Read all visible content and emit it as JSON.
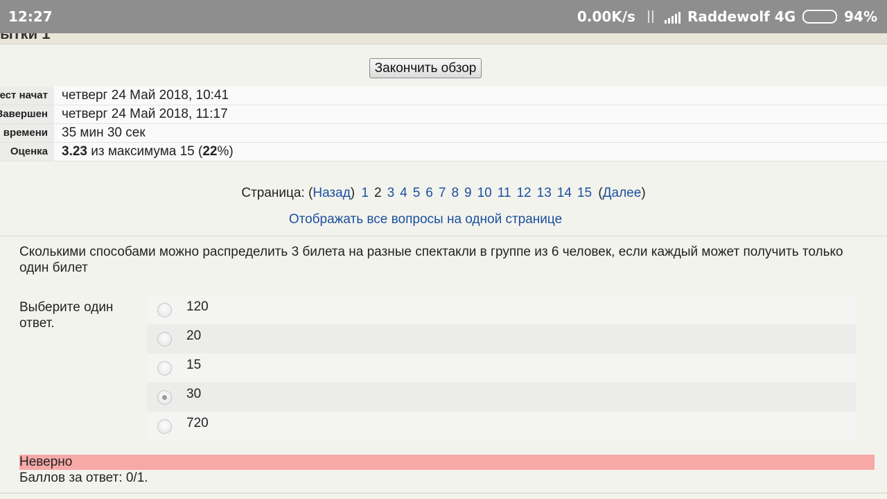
{
  "statusbar": {
    "time": "12:27",
    "speed": "0.00K/s",
    "carrier": "Raddewolf 4G",
    "battery": "94%",
    "battery_level": 0.94
  },
  "page": {
    "title_fragment": "ытки 1",
    "finish_button": "Закончить обзор"
  },
  "summary": {
    "rows": [
      {
        "label": "Тест начат",
        "value": "четверг 24 Май 2018, 10:41"
      },
      {
        "label": "Завершен",
        "value": "четверг 24 Май 2018, 11:17"
      },
      {
        "label": "Прошло времени",
        "value": "35 мин 30 сек"
      },
      {
        "label": "Оценка",
        "grade": "3.23",
        "grade_mid": "из максимума 15 (",
        "percent": "22",
        "grade_end": "%)"
      }
    ]
  },
  "pagination": {
    "prefix": "Страница: (",
    "back": "Назад",
    "close_back": ")",
    "pages": [
      "1",
      "2",
      "3",
      "4",
      "5",
      "6",
      "7",
      "8",
      "9",
      "10",
      "11",
      "12",
      "13",
      "14",
      "15"
    ],
    "current": "2",
    "open_next": "(",
    "next": "Далее",
    "close_next": ")",
    "show_all": "Отображать все вопросы на одной странице"
  },
  "question": {
    "text": "Сколькими способами можно распределить 3 билета на разные спектакли в группе из 6 человек, если каждый может получить только один билет",
    "prompt": "Выберите один ответ.",
    "options": [
      {
        "label": "120",
        "checked": false
      },
      {
        "label": "20",
        "checked": false
      },
      {
        "label": "15",
        "checked": false
      },
      {
        "label": "30",
        "checked": true
      },
      {
        "label": "720",
        "checked": false
      }
    ],
    "result": "Неверно",
    "score": "Баллов за ответ: 0/1."
  }
}
